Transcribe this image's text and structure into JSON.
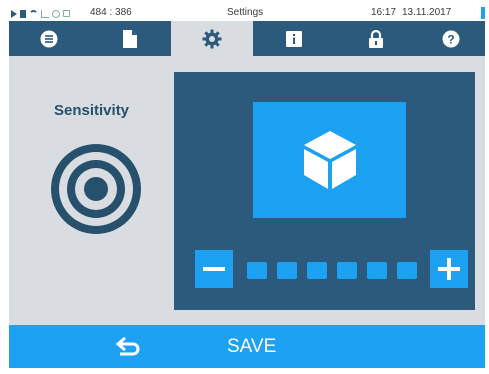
{
  "statusbar": {
    "coords": "484 : 386",
    "title": "Settings",
    "time": "16:17",
    "date": "13.11.2017"
  },
  "tabs": [
    {
      "icon": "list-icon",
      "active": false
    },
    {
      "icon": "document-icon",
      "active": false
    },
    {
      "icon": "gear-icon",
      "active": true
    },
    {
      "icon": "info-book-icon",
      "active": false
    },
    {
      "icon": "lock-icon",
      "active": false
    },
    {
      "icon": "help-icon",
      "active": false
    }
  ],
  "content": {
    "title": "Sensitivity",
    "icon": "target-icon",
    "preview_icon": "cube-icon",
    "level": {
      "value": 6,
      "segments": 6
    },
    "decrease_icon": "minus-icon",
    "increase_icon": "plus-icon"
  },
  "bottombar": {
    "back_icon": "back-arrow-icon",
    "save_label": "SAVE"
  },
  "colors": {
    "accent": "#1da1f2",
    "navy": "#2c5a7c",
    "panel_bg": "#d9dde1",
    "title_text": "#27506c"
  }
}
